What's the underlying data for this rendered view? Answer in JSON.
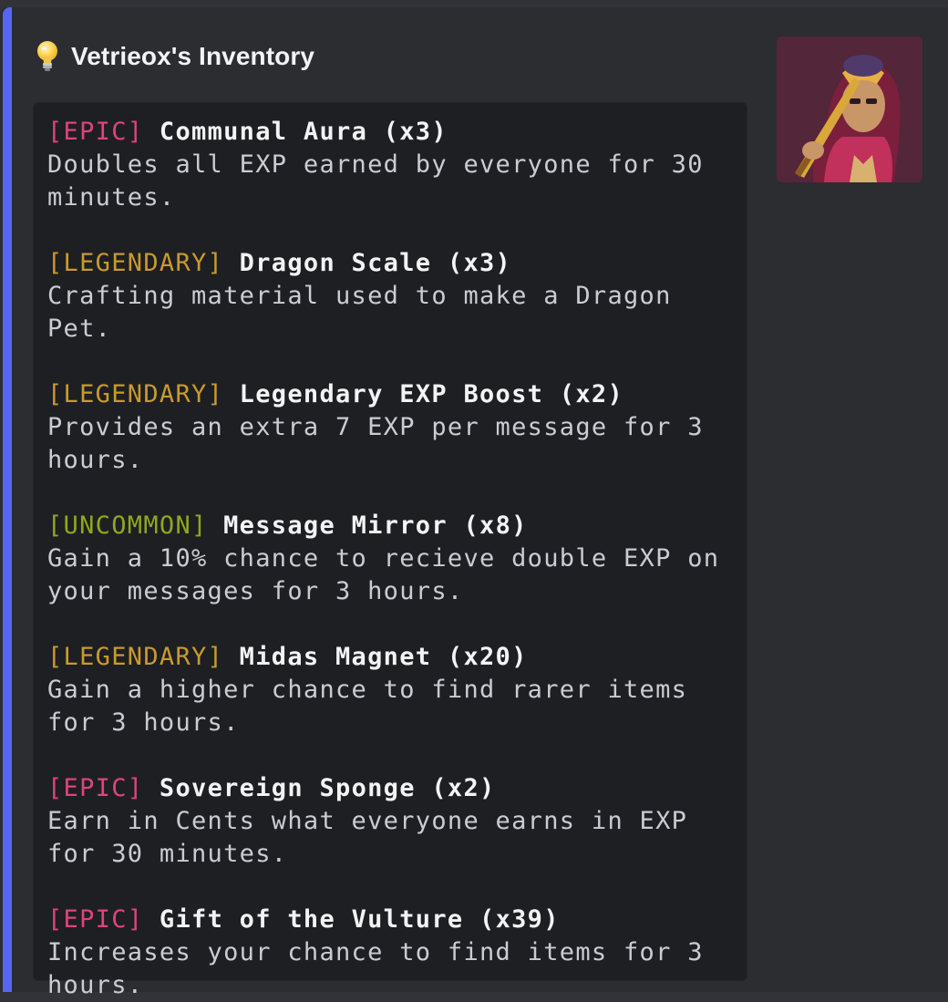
{
  "embed": {
    "accent_color": "#5865f2",
    "title_icon": "lightbulb-icon",
    "title": "Vetrieox's Inventory",
    "thumbnail_icon": "user-avatar-image"
  },
  "colors": {
    "epic": "#e0437a",
    "legendary": "#c99a2e",
    "uncommon": "#8ea81e"
  },
  "items": [
    {
      "rarity": "[EPIC]",
      "rarity_class": "epic",
      "name": "Communal Aura (x3)",
      "description": "Doubles all EXP earned by everyone for 30 minutes."
    },
    {
      "rarity": "[LEGENDARY]",
      "rarity_class": "legendary",
      "name": "Dragon Scale (x3)",
      "description": "Crafting material used to make a Dragon Pet."
    },
    {
      "rarity": "[LEGENDARY]",
      "rarity_class": "legendary",
      "name": "Legendary EXP Boost (x2)",
      "description": "Provides an extra 7 EXP per message for 3 hours."
    },
    {
      "rarity": "[UNCOMMON]",
      "rarity_class": "uncommon",
      "name": "Message Mirror (x8)",
      "description": "Gain a 10% chance to recieve double EXP on your messages for 3 hours."
    },
    {
      "rarity": "[LEGENDARY]",
      "rarity_class": "legendary",
      "name": "Midas Magnet (x20)",
      "description": "Gain a higher chance to find rarer items for 3 hours."
    },
    {
      "rarity": "[EPIC]",
      "rarity_class": "epic",
      "name": "Sovereign Sponge (x2)",
      "description": "Earn in Cents what everyone earns in EXP for 30 minutes."
    },
    {
      "rarity": "[EPIC]",
      "rarity_class": "epic",
      "name": "Gift of the Vulture (x39)",
      "description": "Increases your chance to find items for 3 hours."
    }
  ]
}
